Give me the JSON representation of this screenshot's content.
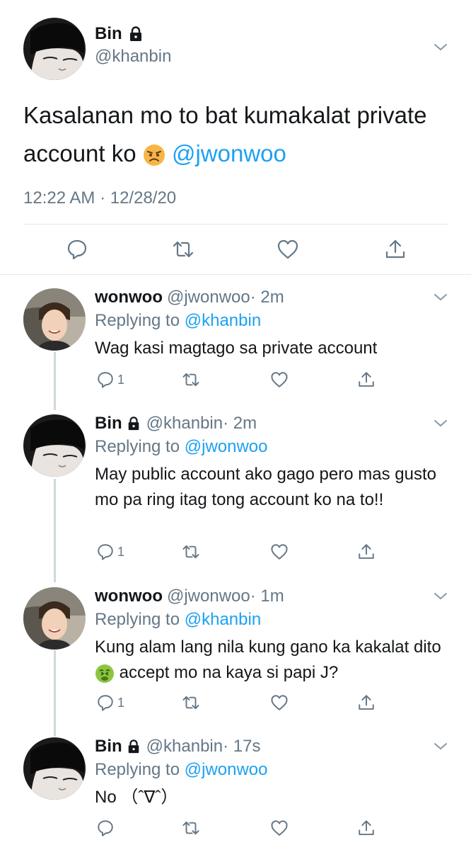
{
  "main_tweet": {
    "name": "Bin",
    "handle": "@khanbin",
    "text_before": "Kasalanan mo to bat kumakalat private account ko",
    "text_mention": "@jwonwoo",
    "emoji": "angry-face",
    "timestamp": "12:22 AM · 12/28/20"
  },
  "replies": [
    {
      "name": "wonwoo",
      "handle": "@jwonwoo",
      "time": "· 2m",
      "locked": false,
      "replying_prefix": "Replying to",
      "replying_to": "@khanbin",
      "body": "Wag kasi magtago sa private account",
      "reply_count": "1"
    },
    {
      "name": "Bin",
      "handle": "@khanbin",
      "time": "· 2m",
      "locked": true,
      "replying_prefix": "Replying to",
      "replying_to": "@jwonwoo",
      "body": "May public account ako gago pero mas gusto mo pa ring itag tong account ko na to!!",
      "reply_count": "1"
    },
    {
      "name": "wonwoo",
      "handle": "@jwonwoo",
      "time": "· 1m",
      "locked": false,
      "replying_prefix": "Replying to",
      "replying_to": "@khanbin",
      "body_before": "Kung alam lang nila kung gano ka kakalat dito",
      "body_emoji": "nauseated-face",
      "body_after": "accept mo na kaya si papi J?",
      "reply_count": "1"
    },
    {
      "name": "Bin",
      "handle": "@khanbin",
      "time": "· 17s",
      "locked": true,
      "replying_prefix": "Replying to",
      "replying_to": "@jwonwoo",
      "body": "No （ˆ∇ˆ）",
      "reply_count": ""
    }
  ],
  "colors": {
    "link": "#1da1f2",
    "secondary": "#657786",
    "divider": "#e1e8ed"
  }
}
